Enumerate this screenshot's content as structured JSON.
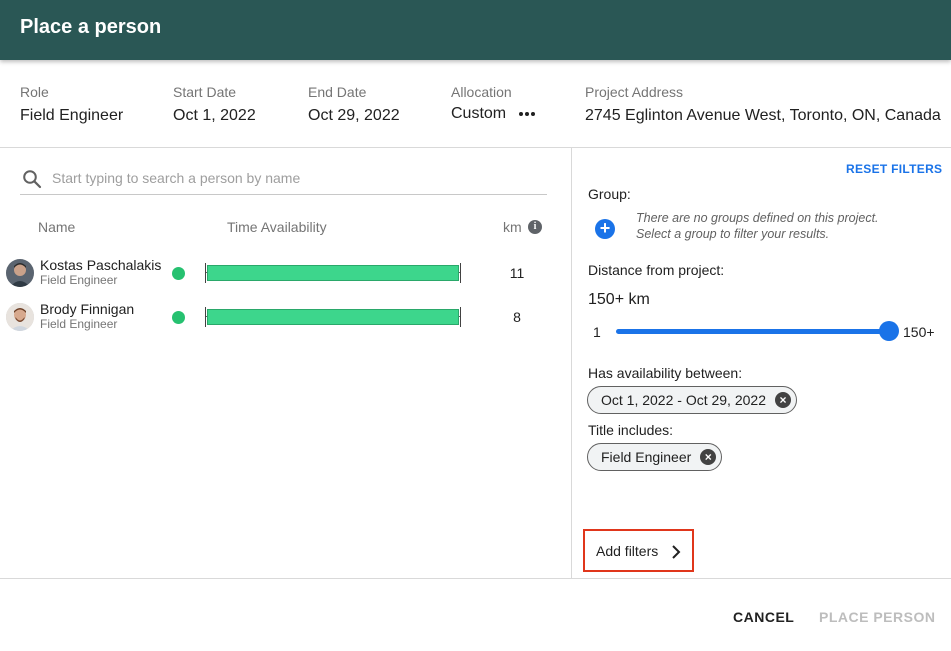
{
  "dialog": {
    "title": "Place a person"
  },
  "summary": {
    "role": {
      "label": "Role",
      "value": "Field Engineer"
    },
    "start": {
      "label": "Start Date",
      "value": "Oct 1, 2022"
    },
    "end": {
      "label": "End Date",
      "value": "Oct 29, 2022"
    },
    "allocation": {
      "label": "Allocation",
      "value": "Custom",
      "menu_icon": "more-horizontal-icon"
    },
    "address": {
      "label": "Project Address",
      "value": "2745 Eglinton Avenue West, Toronto, ON, Canada"
    }
  },
  "search": {
    "placeholder": "Start typing to search a person by name",
    "icon": "search-icon"
  },
  "table": {
    "columns": {
      "name": "Name",
      "availability": "Time Availability",
      "distance": "km",
      "distance_icon": "info-icon"
    },
    "rows": [
      {
        "name": "Kostas Paschalakis",
        "title": "Field Engineer",
        "status": "available",
        "availability_fraction": 1.0,
        "km": "11"
      },
      {
        "name": "Brody Finnigan",
        "title": "Field Engineer",
        "status": "available",
        "availability_fraction": 1.0,
        "km": "8"
      }
    ]
  },
  "filters": {
    "reset": "RESET FILTERS",
    "group": {
      "label": "Group:",
      "empty_message_1": "There are no groups defined on this project.",
      "empty_message_2": "Select a group to filter your results.",
      "add_icon": "plus-icon"
    },
    "distance": {
      "label": "Distance from project:",
      "value": "150+ km",
      "min_label": "1",
      "max_label": "150+",
      "slider_fraction": 1.0
    },
    "availability": {
      "label": "Has availability between:",
      "chip": "Oct 1, 2022 - Oct 29, 2022"
    },
    "title": {
      "label": "Title includes:",
      "chip": "Field Engineer"
    },
    "add": "Add filters"
  },
  "actions": {
    "cancel": "CANCEL",
    "place": "PLACE PERSON"
  },
  "colors": {
    "header": "#2a5755",
    "accent": "#1a73e8",
    "available": "#26c170",
    "bar": "#3dd68c",
    "highlight": "#e0361b"
  }
}
